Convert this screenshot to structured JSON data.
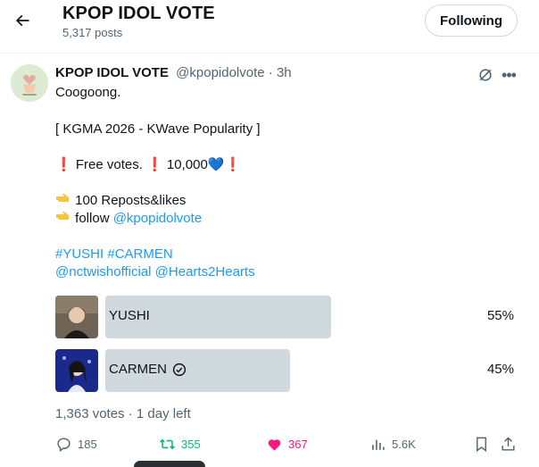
{
  "header": {
    "title": "KPOP IDOL VOTE",
    "post_count": "5,317 posts",
    "follow_label": "Following"
  },
  "post": {
    "author_name": "KPOP IDOL VOTE",
    "author_meta": "@kpopidolvote · 3h",
    "lines": {
      "l1": "Coogoong.",
      "l2": " [ KGMA 2026 - KWave Popularity ]",
      "l3_a": "❗",
      "l3_b": " Free votes. ",
      "l3_c": "❗",
      "l3_d": " 10,000",
      "l3_e": "💙",
      "l3_f": "❗",
      "l4": "100 Reposts&likes",
      "l5_a": "follow ",
      "l5_b": "@kpopidolvote",
      "l6": "#YUSHI #CARMEN",
      "l7_a": "@nctwishofficial",
      "l7_b": "@Hearts2Hearts"
    },
    "poll": {
      "options": [
        {
          "label": "YUSHI",
          "percent": "55%",
          "share": 0.55
        },
        {
          "label": "CARMEN",
          "percent": "45%",
          "share": 0.45
        }
      ],
      "meta": "1,363 votes · 1 day left"
    },
    "actions": {
      "replies": "185",
      "reposts": "355",
      "likes": "367",
      "views": "5.6K"
    }
  },
  "colors": {
    "accent": "#1d9bf0",
    "repost": "#00ba7c",
    "like": "#f91880",
    "muted": "#536471",
    "poll_bar": "#cfd9de"
  }
}
